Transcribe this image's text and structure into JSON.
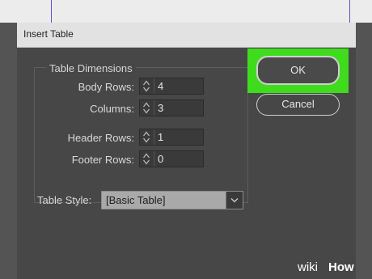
{
  "dialog": {
    "title": "Insert Table"
  },
  "dimensions": {
    "legend": "Table Dimensions",
    "body_rows": {
      "label": "Body Rows:",
      "value": "4"
    },
    "columns": {
      "label": "Columns:",
      "value": "3"
    },
    "header_rows": {
      "label": "Header Rows:",
      "value": "1"
    },
    "footer_rows": {
      "label": "Footer Rows:",
      "value": "0"
    }
  },
  "buttons": {
    "ok": "OK",
    "cancel": "Cancel"
  },
  "table_style": {
    "label": "Table Style:",
    "value": "[Basic Table]"
  },
  "watermark": {
    "prefix": "wiki",
    "brand": "How"
  },
  "colors": {
    "highlight": "#3fdc1e",
    "dialog_bg": "#474747"
  },
  "icons": [
    "spinner-up-icon",
    "spinner-down-icon",
    "chevron-down-icon"
  ]
}
